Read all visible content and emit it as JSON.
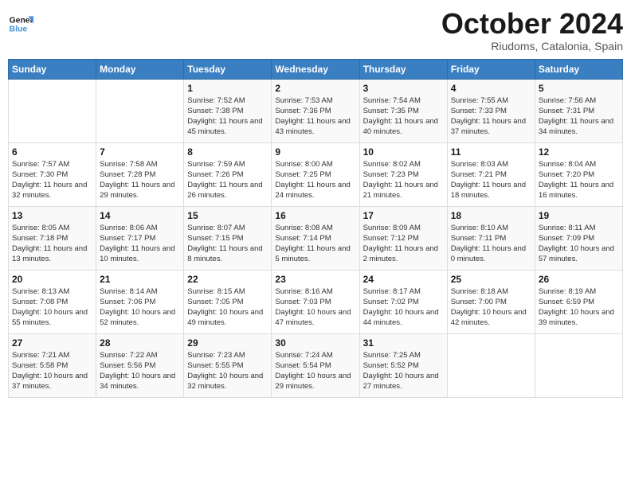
{
  "header": {
    "logo_line1": "General",
    "logo_line2": "Blue",
    "month_title": "October 2024",
    "subtitle": "Riudoms, Catalonia, Spain"
  },
  "days_of_week": [
    "Sunday",
    "Monday",
    "Tuesday",
    "Wednesday",
    "Thursday",
    "Friday",
    "Saturday"
  ],
  "weeks": [
    [
      {
        "day": "",
        "info": ""
      },
      {
        "day": "",
        "info": ""
      },
      {
        "day": "1",
        "info": "Sunrise: 7:52 AM\nSunset: 7:38 PM\nDaylight: 11 hours and 45 minutes."
      },
      {
        "day": "2",
        "info": "Sunrise: 7:53 AM\nSunset: 7:36 PM\nDaylight: 11 hours and 43 minutes."
      },
      {
        "day": "3",
        "info": "Sunrise: 7:54 AM\nSunset: 7:35 PM\nDaylight: 11 hours and 40 minutes."
      },
      {
        "day": "4",
        "info": "Sunrise: 7:55 AM\nSunset: 7:33 PM\nDaylight: 11 hours and 37 minutes."
      },
      {
        "day": "5",
        "info": "Sunrise: 7:56 AM\nSunset: 7:31 PM\nDaylight: 11 hours and 34 minutes."
      }
    ],
    [
      {
        "day": "6",
        "info": "Sunrise: 7:57 AM\nSunset: 7:30 PM\nDaylight: 11 hours and 32 minutes."
      },
      {
        "day": "7",
        "info": "Sunrise: 7:58 AM\nSunset: 7:28 PM\nDaylight: 11 hours and 29 minutes."
      },
      {
        "day": "8",
        "info": "Sunrise: 7:59 AM\nSunset: 7:26 PM\nDaylight: 11 hours and 26 minutes."
      },
      {
        "day": "9",
        "info": "Sunrise: 8:00 AM\nSunset: 7:25 PM\nDaylight: 11 hours and 24 minutes."
      },
      {
        "day": "10",
        "info": "Sunrise: 8:02 AM\nSunset: 7:23 PM\nDaylight: 11 hours and 21 minutes."
      },
      {
        "day": "11",
        "info": "Sunrise: 8:03 AM\nSunset: 7:21 PM\nDaylight: 11 hours and 18 minutes."
      },
      {
        "day": "12",
        "info": "Sunrise: 8:04 AM\nSunset: 7:20 PM\nDaylight: 11 hours and 16 minutes."
      }
    ],
    [
      {
        "day": "13",
        "info": "Sunrise: 8:05 AM\nSunset: 7:18 PM\nDaylight: 11 hours and 13 minutes."
      },
      {
        "day": "14",
        "info": "Sunrise: 8:06 AM\nSunset: 7:17 PM\nDaylight: 11 hours and 10 minutes."
      },
      {
        "day": "15",
        "info": "Sunrise: 8:07 AM\nSunset: 7:15 PM\nDaylight: 11 hours and 8 minutes."
      },
      {
        "day": "16",
        "info": "Sunrise: 8:08 AM\nSunset: 7:14 PM\nDaylight: 11 hours and 5 minutes."
      },
      {
        "day": "17",
        "info": "Sunrise: 8:09 AM\nSunset: 7:12 PM\nDaylight: 11 hours and 2 minutes."
      },
      {
        "day": "18",
        "info": "Sunrise: 8:10 AM\nSunset: 7:11 PM\nDaylight: 11 hours and 0 minutes."
      },
      {
        "day": "19",
        "info": "Sunrise: 8:11 AM\nSunset: 7:09 PM\nDaylight: 10 hours and 57 minutes."
      }
    ],
    [
      {
        "day": "20",
        "info": "Sunrise: 8:13 AM\nSunset: 7:08 PM\nDaylight: 10 hours and 55 minutes."
      },
      {
        "day": "21",
        "info": "Sunrise: 8:14 AM\nSunset: 7:06 PM\nDaylight: 10 hours and 52 minutes."
      },
      {
        "day": "22",
        "info": "Sunrise: 8:15 AM\nSunset: 7:05 PM\nDaylight: 10 hours and 49 minutes."
      },
      {
        "day": "23",
        "info": "Sunrise: 8:16 AM\nSunset: 7:03 PM\nDaylight: 10 hours and 47 minutes."
      },
      {
        "day": "24",
        "info": "Sunrise: 8:17 AM\nSunset: 7:02 PM\nDaylight: 10 hours and 44 minutes."
      },
      {
        "day": "25",
        "info": "Sunrise: 8:18 AM\nSunset: 7:00 PM\nDaylight: 10 hours and 42 minutes."
      },
      {
        "day": "26",
        "info": "Sunrise: 8:19 AM\nSunset: 6:59 PM\nDaylight: 10 hours and 39 minutes."
      }
    ],
    [
      {
        "day": "27",
        "info": "Sunrise: 7:21 AM\nSunset: 5:58 PM\nDaylight: 10 hours and 37 minutes."
      },
      {
        "day": "28",
        "info": "Sunrise: 7:22 AM\nSunset: 5:56 PM\nDaylight: 10 hours and 34 minutes."
      },
      {
        "day": "29",
        "info": "Sunrise: 7:23 AM\nSunset: 5:55 PM\nDaylight: 10 hours and 32 minutes."
      },
      {
        "day": "30",
        "info": "Sunrise: 7:24 AM\nSunset: 5:54 PM\nDaylight: 10 hours and 29 minutes."
      },
      {
        "day": "31",
        "info": "Sunrise: 7:25 AM\nSunset: 5:52 PM\nDaylight: 10 hours and 27 minutes."
      },
      {
        "day": "",
        "info": ""
      },
      {
        "day": "",
        "info": ""
      }
    ]
  ]
}
